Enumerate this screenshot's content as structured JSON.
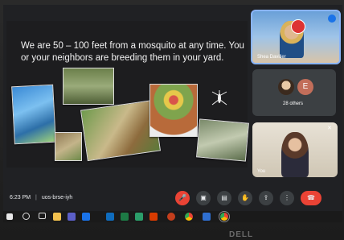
{
  "slide": {
    "text": "We are 50 – 100 feet from a mosquito at any time.  You or your neighbors are breeding them in your yard."
  },
  "participants": {
    "presenter_name": "Shea Daviller",
    "others_label": "28 others",
    "others_initial": "E",
    "self_name": "You"
  },
  "meeting": {
    "time": "6:23 PM",
    "separator": "|",
    "code": "uos-brse-iyh"
  },
  "brand": {
    "logo_text": "DELL"
  },
  "colors": {
    "end_call": "#ea4335",
    "bar": "#202124"
  }
}
